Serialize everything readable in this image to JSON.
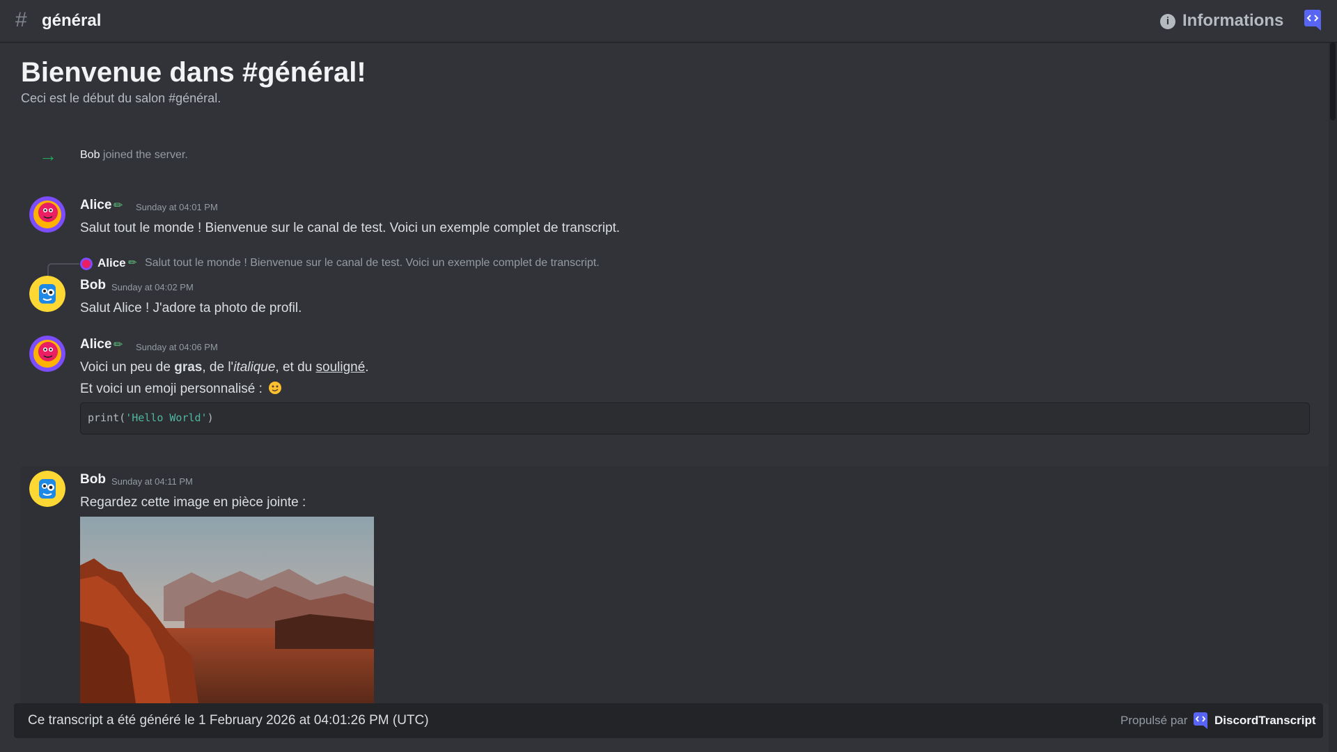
{
  "header": {
    "channel_name": "général",
    "info_label": "Informations"
  },
  "welcome": {
    "title": "Bienvenue dans #général!",
    "subtitle": "Ceci est le début du salon #général."
  },
  "system_message": {
    "user": "Bob",
    "text": " joined the server."
  },
  "messages": [
    {
      "author": "Alice",
      "timestamp": "Sunday at 04:01 PM",
      "text": "Salut tout le monde ! Bienvenue sur le canal de test. Voici un exemple complet de transcript."
    },
    {
      "author": "Bob",
      "timestamp": "Sunday at 04:02 PM",
      "reply": {
        "author": "Alice",
        "text": "Salut tout le monde ! Bienvenue sur le canal de test. Voici un exemple complet de transcript."
      },
      "text": "Salut Alice ! J'adore ta photo de profil."
    },
    {
      "author": "Alice",
      "timestamp": "Sunday at 04:06 PM",
      "line1": {
        "t1": "Voici un peu de ",
        "bold": "gras",
        "t2": ", de l'",
        "italic": "italique",
        "t3": ", et du ",
        "underline": "souligné",
        "t4": "."
      },
      "line2": "Et voici un emoji personnalisé :",
      "code": {
        "fn": "print(",
        "str": "'Hello World'",
        "end": ")"
      }
    },
    {
      "author": "Bob",
      "timestamp": "Sunday at 04:11 PM",
      "text": "Regardez cette image en pièce jointe :"
    }
  ],
  "footer": {
    "generated": "Ce transcript a été généré le 1 February 2026 at 04:01:26 PM (UTC)",
    "powered_by": "Propulsé par",
    "brand": "DiscordTranscript"
  },
  "colors": {
    "background": "#313338",
    "accent": "#5865f2",
    "join_arrow": "#23a55a",
    "code_string": "#4fb7a1"
  }
}
